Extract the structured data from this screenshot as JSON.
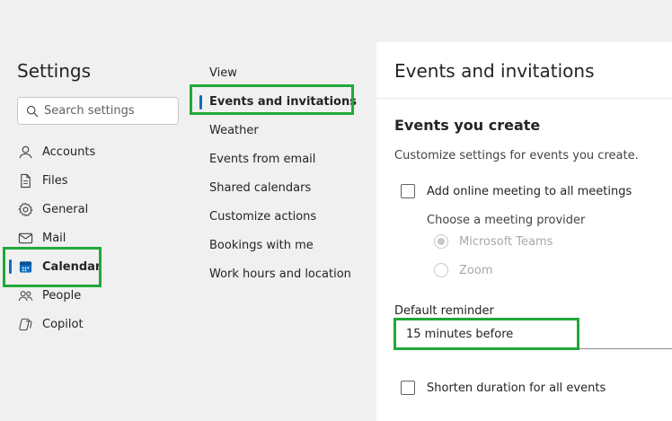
{
  "settings": {
    "title": "Settings",
    "search_placeholder": "Search settings",
    "items": [
      {
        "label": "Accounts",
        "icon": "person-icon"
      },
      {
        "label": "Files",
        "icon": "file-icon"
      },
      {
        "label": "General",
        "icon": "gear-icon"
      },
      {
        "label": "Mail",
        "icon": "mail-icon"
      },
      {
        "label": "Calendar",
        "icon": "calendar-icon",
        "active": true
      },
      {
        "label": "People",
        "icon": "people-icon"
      },
      {
        "label": "Copilot",
        "icon": "copilot-icon"
      }
    ]
  },
  "calendar_menu": {
    "items": [
      {
        "label": "View"
      },
      {
        "label": "Events and invitations",
        "active": true
      },
      {
        "label": "Weather"
      },
      {
        "label": "Events from email"
      },
      {
        "label": "Shared calendars"
      },
      {
        "label": "Customize actions"
      },
      {
        "label": "Bookings with me"
      },
      {
        "label": "Work hours and location"
      }
    ]
  },
  "panel": {
    "title": "Events and invitations",
    "section_title": "Events you create",
    "section_desc": "Customize settings for events you create.",
    "online_meeting_label": "Add online meeting to all meetings",
    "provider_label": "Choose a meeting provider",
    "providers": [
      {
        "label": "Microsoft Teams",
        "selected": true
      },
      {
        "label": "Zoom",
        "selected": false
      }
    ],
    "reminder_label": "Default reminder",
    "reminder_value": "15 minutes before",
    "shorten_label": "Shorten duration for all events"
  },
  "colors": {
    "accent": "#0f6cbd",
    "highlight": "#22a83a"
  }
}
